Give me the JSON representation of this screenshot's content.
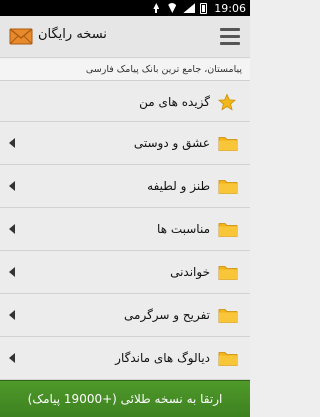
{
  "status_bar": {
    "time": "19:06"
  },
  "header": {
    "app_title": "نسخه رایگان",
    "subtitle": "پیامستان، جامع ترین بانک پیامک فارسی"
  },
  "menu": {
    "items": [
      {
        "label": "گزیده های من",
        "icon": "star-icon"
      },
      {
        "label": "عشق و دوستی",
        "icon": "folder-icon"
      },
      {
        "label": "طنز و لطیفه",
        "icon": "folder-icon"
      },
      {
        "label": "مناسبت ها",
        "icon": "folder-icon"
      },
      {
        "label": "خواندنی",
        "icon": "folder-icon"
      },
      {
        "label": "تفریح و سرگرمی",
        "icon": "folder-icon"
      },
      {
        "label": "دیالوگ های ماندگار",
        "icon": "folder-icon"
      }
    ]
  },
  "footer": {
    "upgrade_label": "ارتقا به نسخه طلائی (+19000 پیامک)"
  },
  "colors": {
    "folder": "#f4b41a",
    "star": "#f1b61a",
    "upgrade_green": "#4a9326"
  }
}
